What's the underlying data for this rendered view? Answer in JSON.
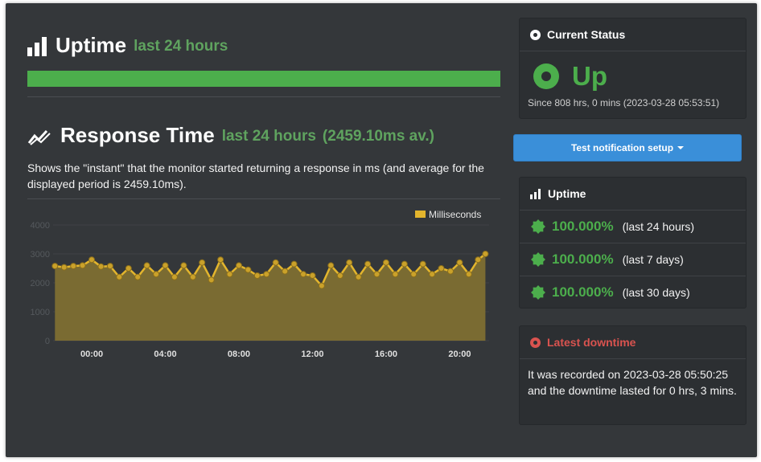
{
  "uptime_section": {
    "title": "Uptime",
    "period": "last 24 hours",
    "bar_percent": 100
  },
  "response_section": {
    "title": "Response Time",
    "period": "last 24 hours",
    "average": "(2459.10ms av.)",
    "description": "Shows the \"instant\" that the monitor started returning a response in ms (and average for the displayed period is 2459.10ms)."
  },
  "chart_data": {
    "type": "area",
    "legend": [
      "Milliseconds"
    ],
    "legend_placement": "top-right",
    "x_ticks": [
      "00:00",
      "04:00",
      "08:00",
      "12:00",
      "16:00",
      "20:00"
    ],
    "y_ticks": [
      "0",
      "1000",
      "2000",
      "3000",
      "4000"
    ],
    "ylim": [
      0,
      4000
    ],
    "xlim_hours": [
      -2.1,
      21.6
    ],
    "grid": true,
    "series": [
      {
        "name": "Milliseconds",
        "x_hours": [
          -2.0,
          -1.5,
          -1.0,
          -0.5,
          0.0,
          0.5,
          1.0,
          1.5,
          2.0,
          2.5,
          3.0,
          3.5,
          4.0,
          4.5,
          5.0,
          5.5,
          6.0,
          6.5,
          7.0,
          7.5,
          8.0,
          8.5,
          9.0,
          9.5,
          10.0,
          10.5,
          11.0,
          11.5,
          12.0,
          12.5,
          13.0,
          13.5,
          14.0,
          14.5,
          15.0,
          15.5,
          16.0,
          16.5,
          17.0,
          17.5,
          18.0,
          18.5,
          19.0,
          19.5,
          20.0,
          20.5,
          21.0,
          21.4
        ],
        "values": [
          2580,
          2540,
          2580,
          2600,
          2800,
          2560,
          2580,
          2200,
          2500,
          2200,
          2600,
          2300,
          2600,
          2200,
          2600,
          2200,
          2700,
          2100,
          2800,
          2300,
          2600,
          2450,
          2250,
          2300,
          2700,
          2400,
          2650,
          2300,
          2250,
          1900,
          2600,
          2250,
          2700,
          2200,
          2650,
          2300,
          2700,
          2300,
          2650,
          2300,
          2650,
          2300,
          2500,
          2400,
          2700,
          2300,
          2800,
          3000
        ]
      }
    ]
  },
  "colors": {
    "uptime_bar": "#4cae4c",
    "series_line": "#e3b52d",
    "series_fill": "#7a6b32",
    "accent_green": "#4cae4c",
    "accent_red": "#d9534f",
    "button_blue": "#3a8fd9"
  },
  "current_status": {
    "title": "Current Status",
    "status": "Up",
    "since": "Since 808 hrs, 0 mins (2023-03-28 05:53:51)"
  },
  "notification_button": {
    "label": "Test notification setup"
  },
  "uptime_card": {
    "title": "Uptime",
    "rows": [
      {
        "percent": "100.000%",
        "period": "(last 24 hours)"
      },
      {
        "percent": "100.000%",
        "period": "(last 7 days)"
      },
      {
        "percent": "100.000%",
        "period": "(last 30 days)"
      }
    ]
  },
  "latest_downtime": {
    "title": "Latest downtime",
    "text": "It was recorded on 2023-03-28 05:50:25 and the downtime lasted for 0 hrs, 3 mins."
  }
}
